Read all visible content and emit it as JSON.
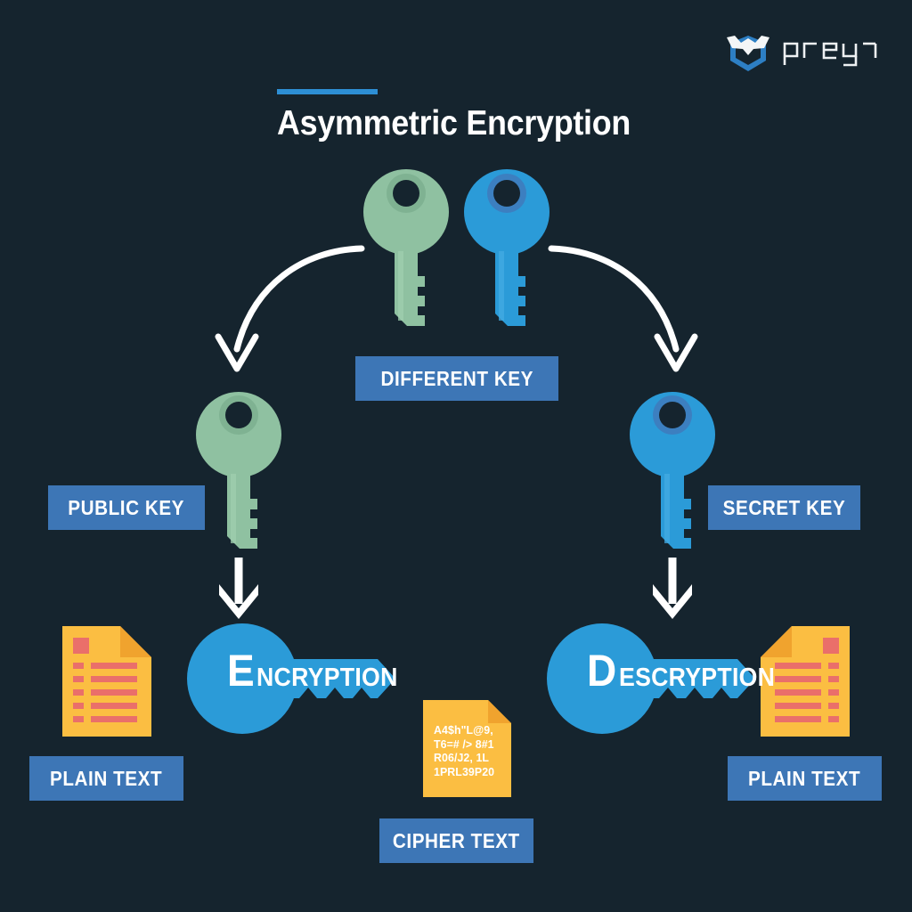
{
  "meta": {
    "background_color": "#15242e",
    "accent_blue": "#2d8fd5",
    "label_blue": "#3d76b6",
    "key_green": "#8fc1a1",
    "key_green_dark": "#7fb292",
    "key_blue": "#2b9bd8",
    "key_blue_ring": "#3c7fc0",
    "doc_yellow": "#fbbe42",
    "doc_fold": "#f0a32e",
    "doc_line_red": "#ea6f6a",
    "white": "#ffffff"
  },
  "brand": {
    "name": "prey",
    "logo_icon": "prey-shield-bird-logo"
  },
  "header": {
    "title": "Asymmetric Encryption"
  },
  "labels": {
    "different_key": "DIFFERENT KEY",
    "public_key": "PUBLIC KEY",
    "secret_key": "SECRET KEY",
    "plain_text_left": "PLAIN TEXT",
    "plain_text_right": "PLAIN TEXT",
    "cipher_text": "CIPHER TEXT"
  },
  "process": {
    "encryption": {
      "initial": "E",
      "rest": "NCRYPTION"
    },
    "decryption": {
      "initial": "D",
      "rest": "ESCRYPTION"
    }
  },
  "cipher_document": {
    "lines": [
      "A4$h\"L@9,",
      "T6=# /> 8#1",
      "R06/J2, 1L",
      "1PRL39P20"
    ]
  },
  "diagram": {
    "top_keys": [
      {
        "name": "green-key",
        "color": "#8fc1a1"
      },
      {
        "name": "blue-key",
        "color": "#2b9bd8"
      }
    ],
    "arrows": [
      {
        "name": "curved-arrow-left",
        "direction": "down-left"
      },
      {
        "name": "curved-arrow-right",
        "direction": "down-right"
      },
      {
        "name": "down-arrow-left",
        "direction": "down"
      },
      {
        "name": "down-arrow-right",
        "direction": "down"
      }
    ],
    "documents": [
      {
        "name": "plain-text-document-left",
        "type": "plain"
      },
      {
        "name": "cipher-text-document",
        "type": "cipher"
      },
      {
        "name": "plain-text-document-right",
        "type": "plain"
      }
    ]
  }
}
